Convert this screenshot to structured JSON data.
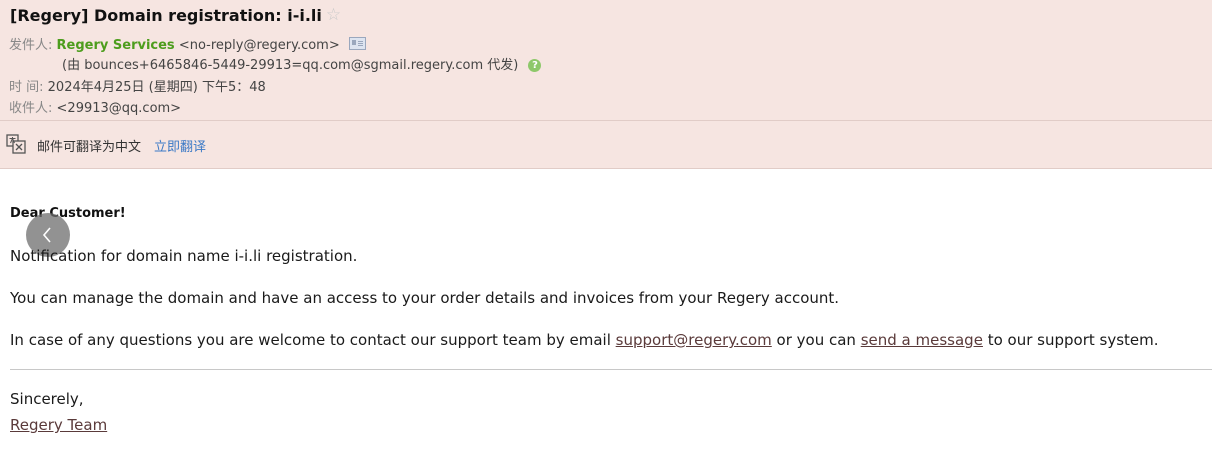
{
  "subject": "[Regery] Domain registration: i-i.li",
  "meta": {
    "from_label": "发件人:",
    "sender_name": "Regery Services",
    "sender_email": "<no-reply@regery.com>",
    "proxy_text": "(由 bounces+6465846-5449-29913=qq.com@sgmail.regery.com 代发)",
    "time_label": "时 间:",
    "time_value": "2024年4月25日 (星期四) 下午5：48",
    "to_label": "收件人:",
    "to_value": "<29913@qq.com>"
  },
  "translate": {
    "text": "邮件可翻译为中文",
    "link": "立即翻译"
  },
  "body": {
    "greeting": "Dear Customer!",
    "p1": "Notification for domain name i-i.li registration.",
    "p2": "You can manage the domain and have an access to your order details and invoices from your Regery account.",
    "p3_a": "In case of any questions you are welcome to contact our support team by email ",
    "p3_email": "support@regery.com",
    "p3_b": " or you can ",
    "p3_link": "send a message",
    "p3_c": " to our support system.",
    "sign1": "Sincerely,",
    "sign2": "Regery Team"
  },
  "icons": {
    "star": "star-icon",
    "contact_card": "contact-card-icon",
    "help": "help-icon",
    "translate": "translate-icon",
    "back": "chevron-left-icon"
  },
  "colors": {
    "header_bg": "#f6e5e1",
    "sender_green": "#4d9d1d",
    "link_blue": "#3b79c6"
  }
}
